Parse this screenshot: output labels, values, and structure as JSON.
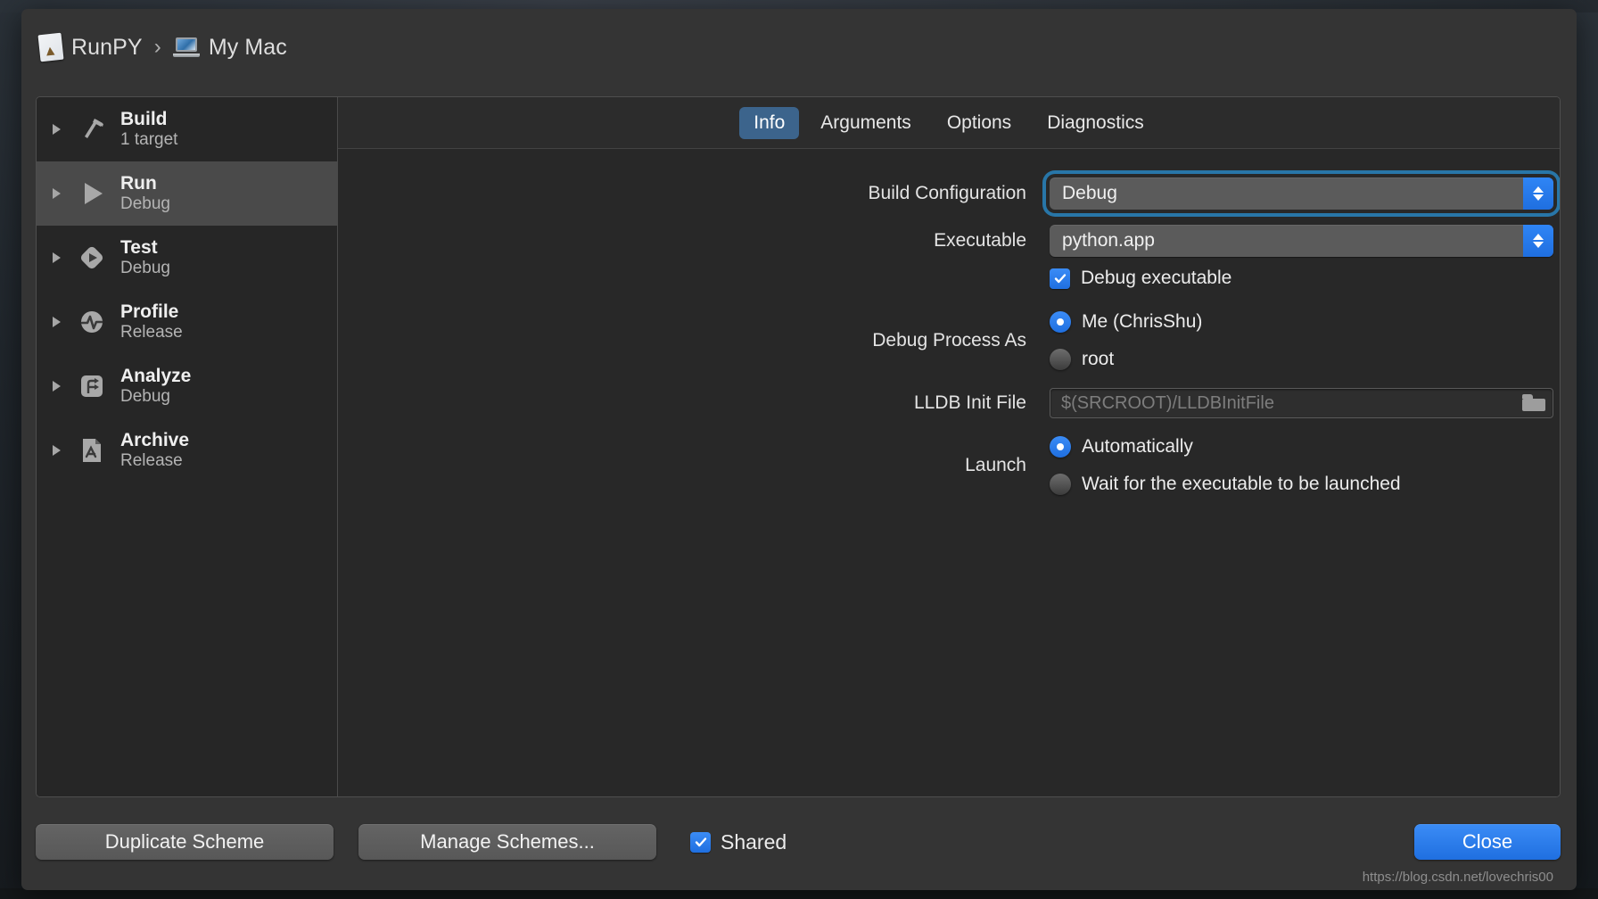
{
  "window": {
    "breadcrumb": {
      "scheme_name": "RunPY",
      "separator": "›",
      "destination": "My Mac",
      "scheme_icon": "scheme-document-icon",
      "destination_icon": "macbook-icon"
    }
  },
  "sidebar": {
    "items": [
      {
        "title": "Build",
        "subtitle": "1 target",
        "icon": "hammer-icon",
        "selected": false
      },
      {
        "title": "Run",
        "subtitle": "Debug",
        "icon": "play-icon",
        "selected": true
      },
      {
        "title": "Test",
        "subtitle": "Debug",
        "icon": "test-diamond-icon",
        "selected": false
      },
      {
        "title": "Profile",
        "subtitle": "Release",
        "icon": "pulse-icon",
        "selected": false
      },
      {
        "title": "Analyze",
        "subtitle": "Debug",
        "icon": "analyze-icon",
        "selected": false
      },
      {
        "title": "Archive",
        "subtitle": "Release",
        "icon": "archive-app-icon",
        "selected": false
      }
    ],
    "disclosure_icon": "disclosure-triangle-icon"
  },
  "tabs": [
    {
      "label": "Info",
      "active": true
    },
    {
      "label": "Arguments",
      "active": false
    },
    {
      "label": "Options",
      "active": false
    },
    {
      "label": "Diagnostics",
      "active": false
    }
  ],
  "form": {
    "build_configuration": {
      "label": "Build Configuration",
      "value": "Debug",
      "focused": true,
      "stepper_icon": "chevron-up-down-icon"
    },
    "executable": {
      "label": "Executable",
      "value": "python.app",
      "stepper_icon": "chevron-up-down-icon"
    },
    "debug_executable": {
      "label": "Debug executable",
      "checked": true,
      "icon": "checkmark-icon"
    },
    "debug_process_as": {
      "label": "Debug Process As",
      "options": [
        {
          "label": "Me (ChrisShu)",
          "selected": true
        },
        {
          "label": "root",
          "selected": false
        }
      ]
    },
    "lldb_init_file": {
      "label": "LLDB Init File",
      "value": "",
      "placeholder": "$(SRCROOT)/LLDBInitFile",
      "browse_icon": "folder-icon"
    },
    "launch": {
      "label": "Launch",
      "options": [
        {
          "label": "Automatically",
          "selected": true
        },
        {
          "label": "Wait for the executable to be launched",
          "selected": false
        }
      ]
    }
  },
  "footer": {
    "duplicate_scheme": "Duplicate Scheme",
    "manage_schemes": "Manage Schemes...",
    "shared": {
      "label": "Shared",
      "checked": true,
      "icon": "checkmark-icon"
    },
    "close": "Close"
  },
  "watermark": "https://blog.csdn.net/lovechris00",
  "colors": {
    "accent_blue": "#2f85f5",
    "active_tab_blue": "#3c648c",
    "focus_ring": "#287aaf",
    "sheet_bg": "#343434",
    "card_bg": "#282828",
    "sidebar_bg": "#262626",
    "selected_row": "#4a4a4a"
  }
}
